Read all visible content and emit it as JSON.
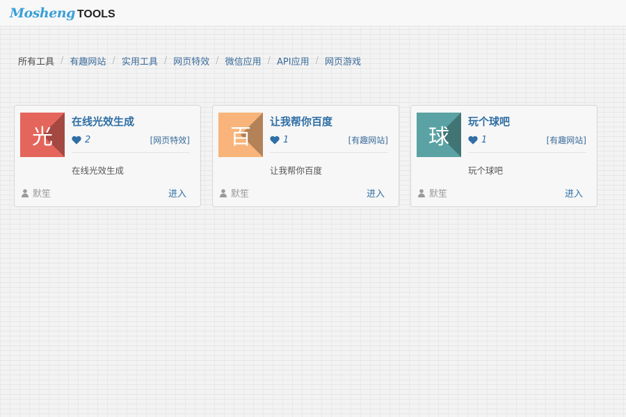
{
  "brand": {
    "script": "Mosheng",
    "suffix": "TOOLS",
    "accent": "#3c9fd8"
  },
  "breadcrumb": [
    {
      "label": "所有工具",
      "link": false
    },
    {
      "label": "有趣网站",
      "link": true
    },
    {
      "label": "实用工具",
      "link": true
    },
    {
      "label": "网页特效",
      "link": true
    },
    {
      "label": "微信应用",
      "link": true
    },
    {
      "label": "API应用",
      "link": true
    },
    {
      "label": "网页游戏",
      "link": true
    }
  ],
  "cards": [
    {
      "char": "光",
      "color": "#e4655c",
      "title": "在线光效生成",
      "likes": "2",
      "tag": "[网页特效]",
      "desc": "在线光效生成",
      "author": "默笙",
      "action": "进入"
    },
    {
      "char": "百",
      "color": "#f8b47a",
      "title": "让我帮你百度",
      "likes": "1",
      "tag": "[有趣网站]",
      "desc": "让我帮你百度",
      "author": "默笙",
      "action": "进入"
    },
    {
      "char": "球",
      "color": "#5aa2a3",
      "title": "玩个球吧",
      "likes": "1",
      "tag": "[有趣网站]",
      "desc": "玩个球吧",
      "author": "默笙",
      "action": "进入"
    }
  ],
  "icons": {
    "like": "heart-icon",
    "author": "user-icon"
  }
}
